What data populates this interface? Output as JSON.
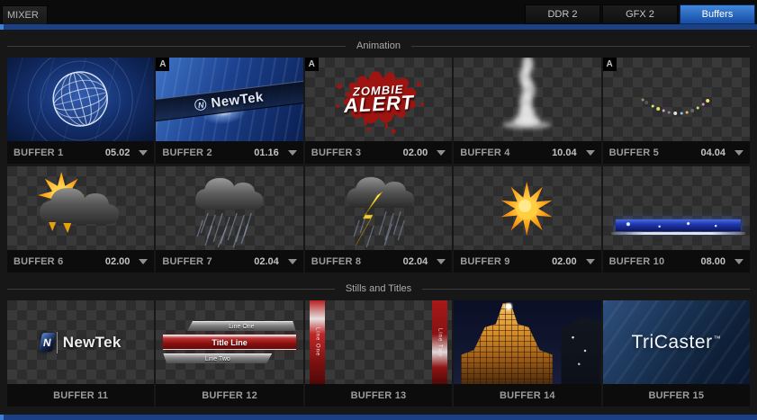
{
  "window": {
    "mixer_tab": "MIXER"
  },
  "tabs": [
    {
      "label": "DDR 2",
      "active": false
    },
    {
      "label": "GFX 2",
      "active": false
    },
    {
      "label": "Buffers",
      "active": true
    }
  ],
  "colors": {
    "accent_blue": "#3f7fd6",
    "bar_blue": "#1b4086",
    "active_tab_top": "#4287dc",
    "active_tab_bottom": "#1a52a8",
    "panel_bg": "#171717"
  },
  "sections": [
    {
      "title": "Animation",
      "buffers": [
        {
          "name": "BUFFER 1",
          "duration": "05.02",
          "badge": "",
          "thumb": "globe"
        },
        {
          "name": "BUFFER 2",
          "duration": "01.16",
          "badge": "A",
          "thumb": "newtek-banner",
          "thumb_text": "NewTek"
        },
        {
          "name": "BUFFER 3",
          "duration": "02.00",
          "badge": "A",
          "thumb": "zombie-alert",
          "line1": "ZOMBIE",
          "line2": "ALERT"
        },
        {
          "name": "BUFFER 4",
          "duration": "10.04",
          "badge": "",
          "thumb": "smoke"
        },
        {
          "name": "BUFFER 5",
          "duration": "04.04",
          "badge": "A",
          "thumb": "sparkles"
        },
        {
          "name": "BUFFER 6",
          "duration": "02.00",
          "badge": "",
          "thumb": "sun-cloud"
        },
        {
          "name": "BUFFER 7",
          "duration": "02.04",
          "badge": "",
          "thumb": "rain-cloud"
        },
        {
          "name": "BUFFER 8",
          "duration": "02.04",
          "badge": "",
          "thumb": "storm-cloud"
        },
        {
          "name": "BUFFER 9",
          "duration": "02.00",
          "badge": "",
          "thumb": "sun"
        },
        {
          "name": "BUFFER 10",
          "duration": "08.00",
          "badge": "",
          "thumb": "blue-banner"
        }
      ]
    },
    {
      "title": "Stills and Titles",
      "buffers": [
        {
          "name": "BUFFER 11",
          "duration": "",
          "badge": "",
          "thumb": "newtek-logo",
          "thumb_text": "NewTek"
        },
        {
          "name": "BUFFER 12",
          "duration": "",
          "badge": "",
          "thumb": "title-lines",
          "lines": [
            "Line One",
            "Title Line",
            "Line Two"
          ]
        },
        {
          "name": "BUFFER 13",
          "duration": "",
          "badge": "",
          "thumb": "vertical-banner",
          "lines": [
            "Line One",
            "Line Two"
          ]
        },
        {
          "name": "BUFFER 14",
          "duration": "",
          "badge": "",
          "thumb": "building"
        },
        {
          "name": "BUFFER 15",
          "duration": "",
          "badge": "",
          "thumb": "tricaster",
          "thumb_text": "TriCaster",
          "trademark": "™"
        }
      ]
    }
  ]
}
